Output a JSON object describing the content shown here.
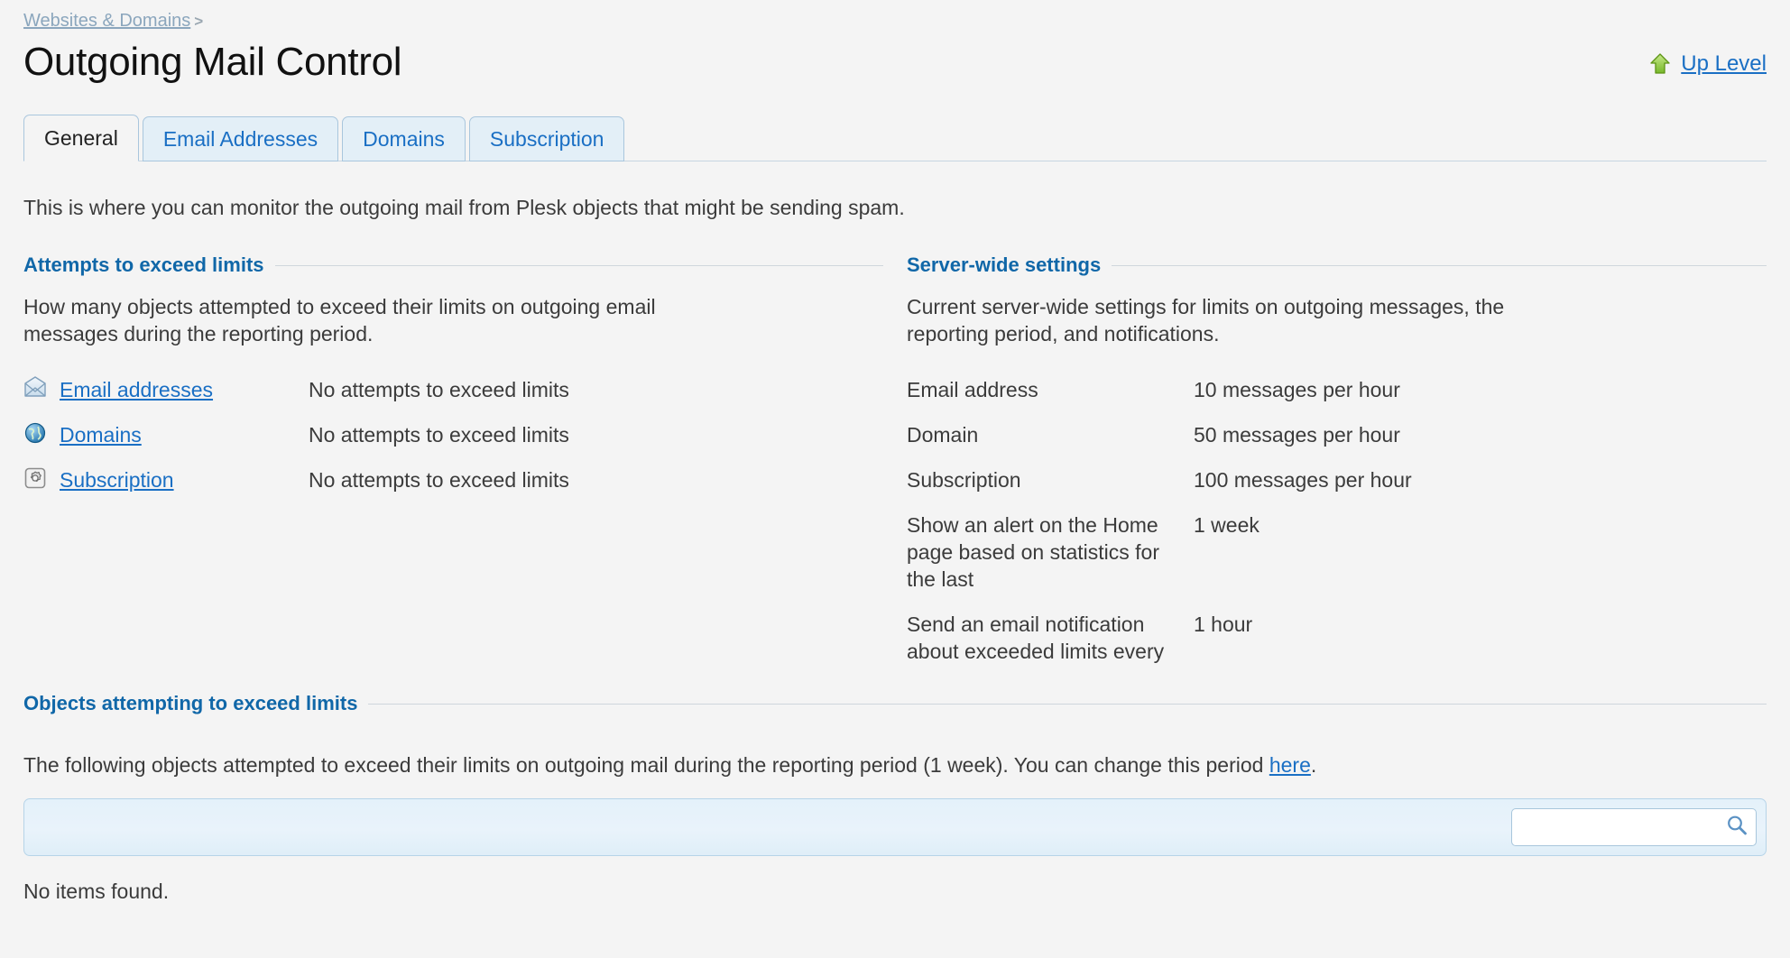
{
  "breadcrumb": {
    "parent": "Websites & Domains",
    "separator": ">"
  },
  "header": {
    "title": "Outgoing Mail Control",
    "up_level_label": "Up Level",
    "up_level_icon": "up-arrow-green-icon"
  },
  "tabs": [
    {
      "label": "General",
      "active": true
    },
    {
      "label": "Email Addresses",
      "active": false
    },
    {
      "label": "Domains",
      "active": false
    },
    {
      "label": "Subscription",
      "active": false
    }
  ],
  "intro": "This is where you can monitor the outgoing mail from Plesk objects that might be sending spam.",
  "attempts": {
    "heading": "Attempts to exceed limits",
    "description": "How many objects attempted to exceed their limits on outgoing email messages during the reporting period.",
    "rows": [
      {
        "icon": "envelope-icon",
        "label": "Email addresses",
        "value": "No attempts to exceed limits"
      },
      {
        "icon": "globe-icon",
        "label": "Domains",
        "value": "No attempts to exceed limits"
      },
      {
        "icon": "subscription-gear-icon",
        "label": "Subscription",
        "value": "No attempts to exceed limits"
      }
    ]
  },
  "server_settings": {
    "heading": "Server-wide settings",
    "description": "Current server-wide settings for limits on outgoing messages, the reporting period, and notifications.",
    "rows": [
      {
        "label": "Email address",
        "value": "10 messages per hour"
      },
      {
        "label": "Domain",
        "value": "50 messages per hour"
      },
      {
        "label": "Subscription",
        "value": "100 messages per hour"
      },
      {
        "label": "Show an alert on the Home page based on statistics for the last",
        "value": "1 week"
      },
      {
        "label": "Send an email notification about exceeded limits every",
        "value": "1 hour"
      }
    ]
  },
  "objects": {
    "heading": "Objects attempting to exceed limits",
    "description_before": "The following objects attempted to exceed their limits on outgoing mail during the reporting period (1 week). You can change this period ",
    "description_link": "here",
    "description_after": ".",
    "search": {
      "value": "",
      "placeholder": "",
      "icon": "search-icon"
    },
    "empty_message": "No items found."
  },
  "colors": {
    "page_background": "#f4f4f4",
    "link": "#1a6fc4",
    "section_heading": "#1067a8",
    "breadcrumb": "#8ba6bd",
    "tab_inactive_background": "#e3eff7",
    "toolbar_background": "#e4f1fa",
    "text": "#3b3b3b"
  }
}
